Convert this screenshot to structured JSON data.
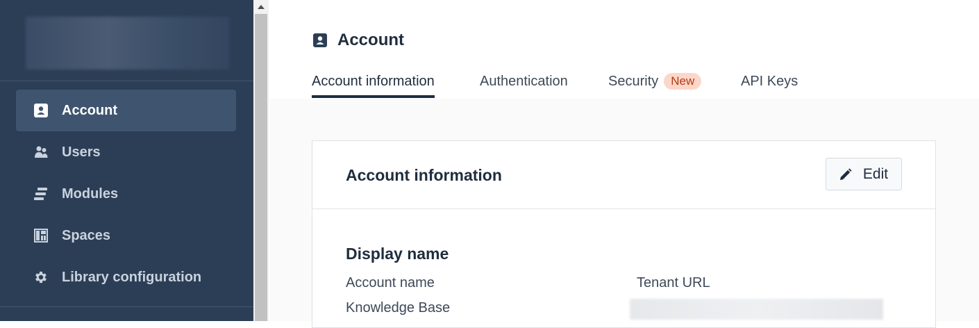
{
  "sidebar": {
    "items": [
      {
        "label": "Account",
        "icon": "account-icon",
        "active": true
      },
      {
        "label": "Users",
        "icon": "users-icon",
        "active": false
      },
      {
        "label": "Modules",
        "icon": "modules-icon",
        "active": false
      },
      {
        "label": "Spaces",
        "icon": "spaces-icon",
        "active": false
      },
      {
        "label": "Library configuration",
        "icon": "gear-icon",
        "active": false
      }
    ]
  },
  "header": {
    "title": "Account",
    "icon": "account-icon"
  },
  "tabs": [
    {
      "label": "Account information",
      "active": true
    },
    {
      "label": "Authentication",
      "active": false
    },
    {
      "label": "Security",
      "badge": "New",
      "active": false
    },
    {
      "label": "API Keys",
      "active": false
    }
  ],
  "card": {
    "title": "Account information",
    "edit_label": "Edit",
    "section_title": "Display name",
    "fields": {
      "account_name": "Account name",
      "tenant_url": "Tenant URL",
      "knowledge_base": "Knowledge Base"
    }
  },
  "colors": {
    "sidebar_bg": "#2c3e56",
    "sidebar_active": "#3f546f",
    "badge_bg": "#fcd7c9",
    "badge_text": "#b43b14",
    "text_dark": "#1f2d3d"
  }
}
